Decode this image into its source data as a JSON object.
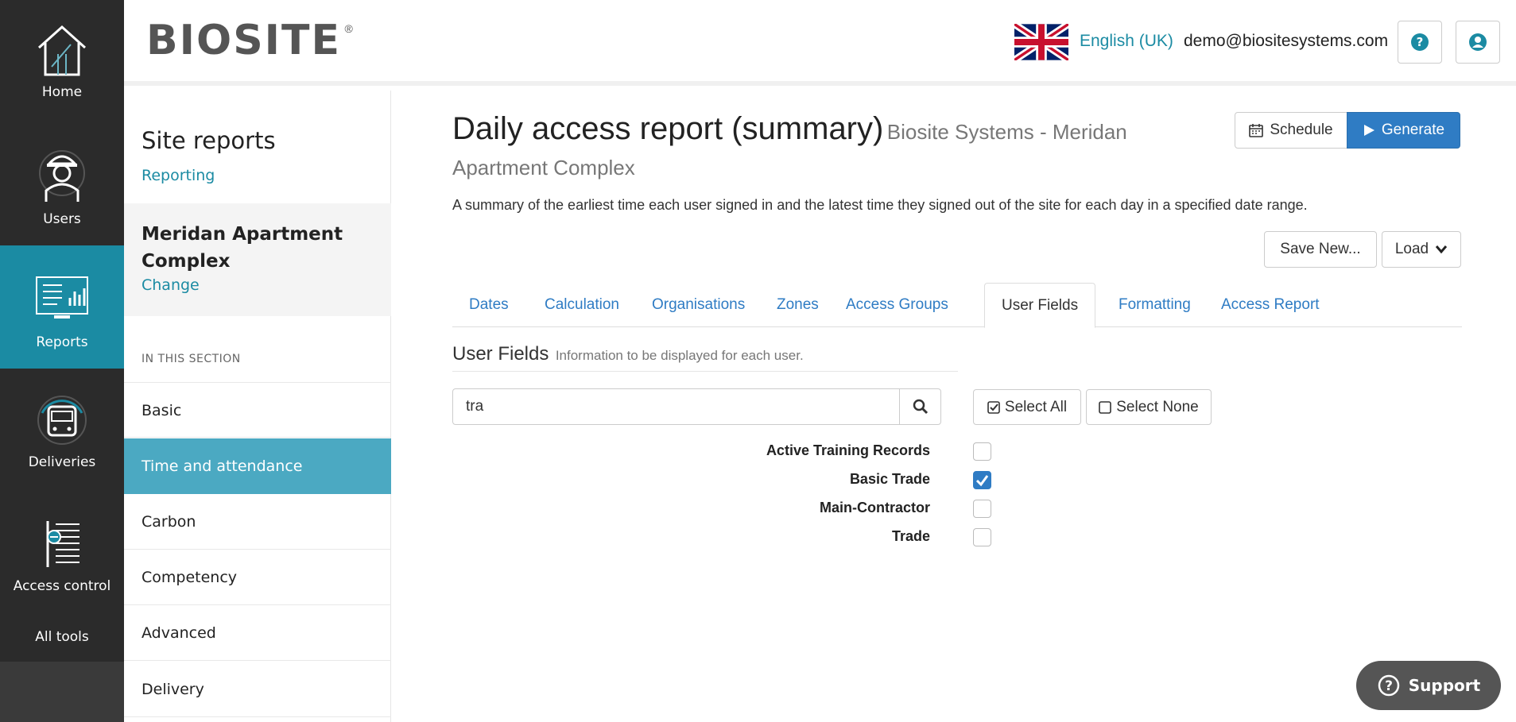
{
  "nav": {
    "home": "Home",
    "users": "Users",
    "reports": "Reports",
    "deliveries": "Deliveries",
    "access_control": "Access control",
    "all_tools": "All tools"
  },
  "header": {
    "logo": "BIOSITE",
    "language": "English (UK)",
    "email": "demo@biositesystems.com"
  },
  "sidebar": {
    "title": "Site reports",
    "reporting_link": "Reporting",
    "site_name": "Meridan Apartment Complex",
    "change_link": "Change",
    "section_label": "IN THIS SECTION",
    "items": [
      "Basic",
      "Time and attendance",
      "Carbon",
      "Competency",
      "Advanced",
      "Delivery"
    ]
  },
  "main": {
    "title": "Daily access report (summary)",
    "subtitle": "Biosite Systems - Meridan Apartment Complex",
    "description": "A summary of the earliest time each user signed in and the latest time they signed out of the site for each day in a specified date range.",
    "schedule_label": "Schedule",
    "generate_label": "Generate",
    "save_new_label": "Save New...",
    "load_label": "Load",
    "tabs": [
      "Dates",
      "Calculation",
      "Organisations",
      "Zones",
      "Access Groups",
      "User Fields",
      "Formatting",
      "Access Report"
    ],
    "active_tab": "User Fields",
    "user_fields": {
      "heading": "User Fields",
      "subheading": "Information to be displayed for each user.",
      "search_value": "tra",
      "select_all_label": "Select All",
      "select_none_label": "Select None",
      "fields": [
        {
          "label": "Active Training Records",
          "checked": false
        },
        {
          "label": "Basic Trade",
          "checked": true
        },
        {
          "label": "Main-Contractor",
          "checked": false
        },
        {
          "label": "Trade",
          "checked": false
        }
      ]
    }
  },
  "support_label": "Support",
  "colors": {
    "accent": "#1b8ba3",
    "primary": "#2f7cc4",
    "nav_bg": "#2b2b2b"
  }
}
